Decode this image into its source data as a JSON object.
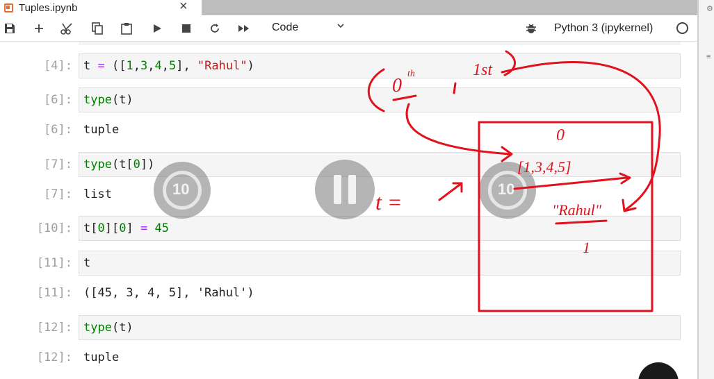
{
  "tab": {
    "title": "Tuples.ipynb",
    "close": "×"
  },
  "toolbar": {
    "cell_type": "Code",
    "kernel_name": "Python 3 (ipykernel)",
    "icons": [
      "save-icon",
      "add-cell-icon",
      "cut-icon",
      "copy-icon",
      "paste-icon",
      "run-icon",
      "stop-icon",
      "restart-icon",
      "run-all-icon",
      "bug-icon"
    ]
  },
  "cells": [
    {
      "kind": "in",
      "prompt": "[4]:"
    },
    {
      "kind": "in",
      "prompt": "[6]:"
    },
    {
      "kind": "out",
      "prompt": "[6]:",
      "text": "tuple"
    },
    {
      "kind": "in",
      "prompt": "[7]:"
    },
    {
      "kind": "out",
      "prompt": "[7]:",
      "text": "list"
    },
    {
      "kind": "in",
      "prompt": "[10]:"
    },
    {
      "kind": "in",
      "prompt": "[11]:",
      "text": "t"
    },
    {
      "kind": "out",
      "prompt": "[11]:",
      "text": "([45, 3, 4, 5], 'Rahul')"
    },
    {
      "kind": "in",
      "prompt": "[12]:"
    },
    {
      "kind": "out",
      "prompt": "[12]:",
      "text": "tuple"
    }
  ],
  "code_tokens": {
    "c4": [
      "t ",
      "=",
      " ([",
      "1",
      ",",
      "3",
      ",",
      "4",
      ",",
      "5",
      "], ",
      "\"Rahul\"",
      ")"
    ],
    "c6": [
      "type",
      "(t)"
    ],
    "c7": [
      "type",
      "(t[",
      "0",
      "])"
    ],
    "c10": [
      "t[",
      "0",
      "][",
      "0",
      "] ",
      "=",
      " ",
      "45"
    ],
    "c12": [
      "type",
      "(t)"
    ]
  },
  "overlay": {
    "rewind_label": "10",
    "forward_label": "10"
  },
  "annotation": {
    "index_zero": "0",
    "index_one": "1st",
    "index_zero_sup": "th",
    "var_label": "t =",
    "box_top": "0",
    "list_text": "[1,3,4,5]",
    "string_text": "\"Rahul\"",
    "box_bottom": "1"
  },
  "colors": {
    "ink": "#e0121d",
    "keyword": "#008000",
    "string": "#ba2121",
    "operator": "#aa22ff",
    "accent": "#e46e2e"
  }
}
